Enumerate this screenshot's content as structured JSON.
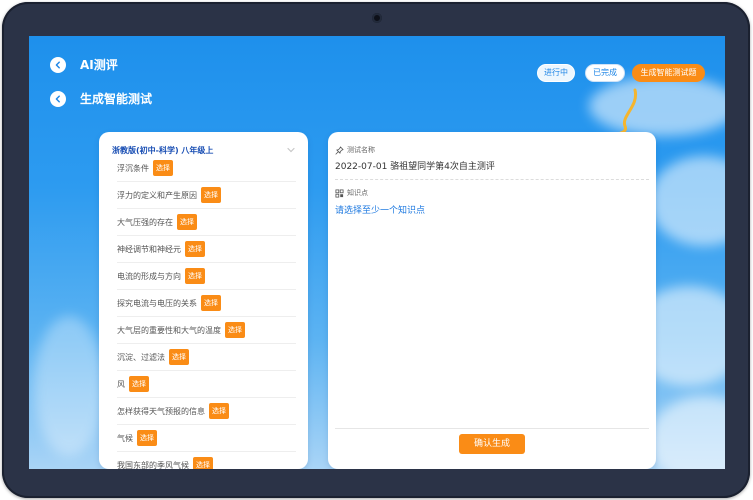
{
  "header": {
    "back_title_1": "AI测评",
    "back_title_2": "生成智能测试",
    "status_tabs": [
      "进行中",
      "已完成"
    ],
    "generate_button": "生成智能测试题"
  },
  "knowledge_panel": {
    "grade": "浙教版(初中-科学) 八年级上",
    "select_label": "选择",
    "items": [
      "浮沉条件",
      "浮力的定义和产生原因",
      "大气压强的存在",
      "神经调节和神经元",
      "电流的形成与方向",
      "探究电流与电压的关系",
      "大气层的重要性和大气的温度",
      "沉淀、过滤法",
      "风",
      "怎样获得天气预报的信息",
      "气候",
      "我国东部的季风气候"
    ]
  },
  "test_form": {
    "name_label": "测试名称",
    "name_value": "2022-07-01 骆祖望同学第4次自主测评",
    "kp_label": "知识点",
    "kp_hint": "请选择至少一个知识点",
    "confirm_button": "确认生成"
  },
  "colors": {
    "accent_orange": "#fa8c16",
    "link_blue": "#1f7ae0",
    "sky_blue": "#1e90ec",
    "arrow_yellow": "#f5b52e"
  },
  "icons": {
    "back": "chevron-left-icon",
    "dropdown": "chevron-down-icon",
    "pin": "pin-icon",
    "grid": "grid-icon"
  }
}
